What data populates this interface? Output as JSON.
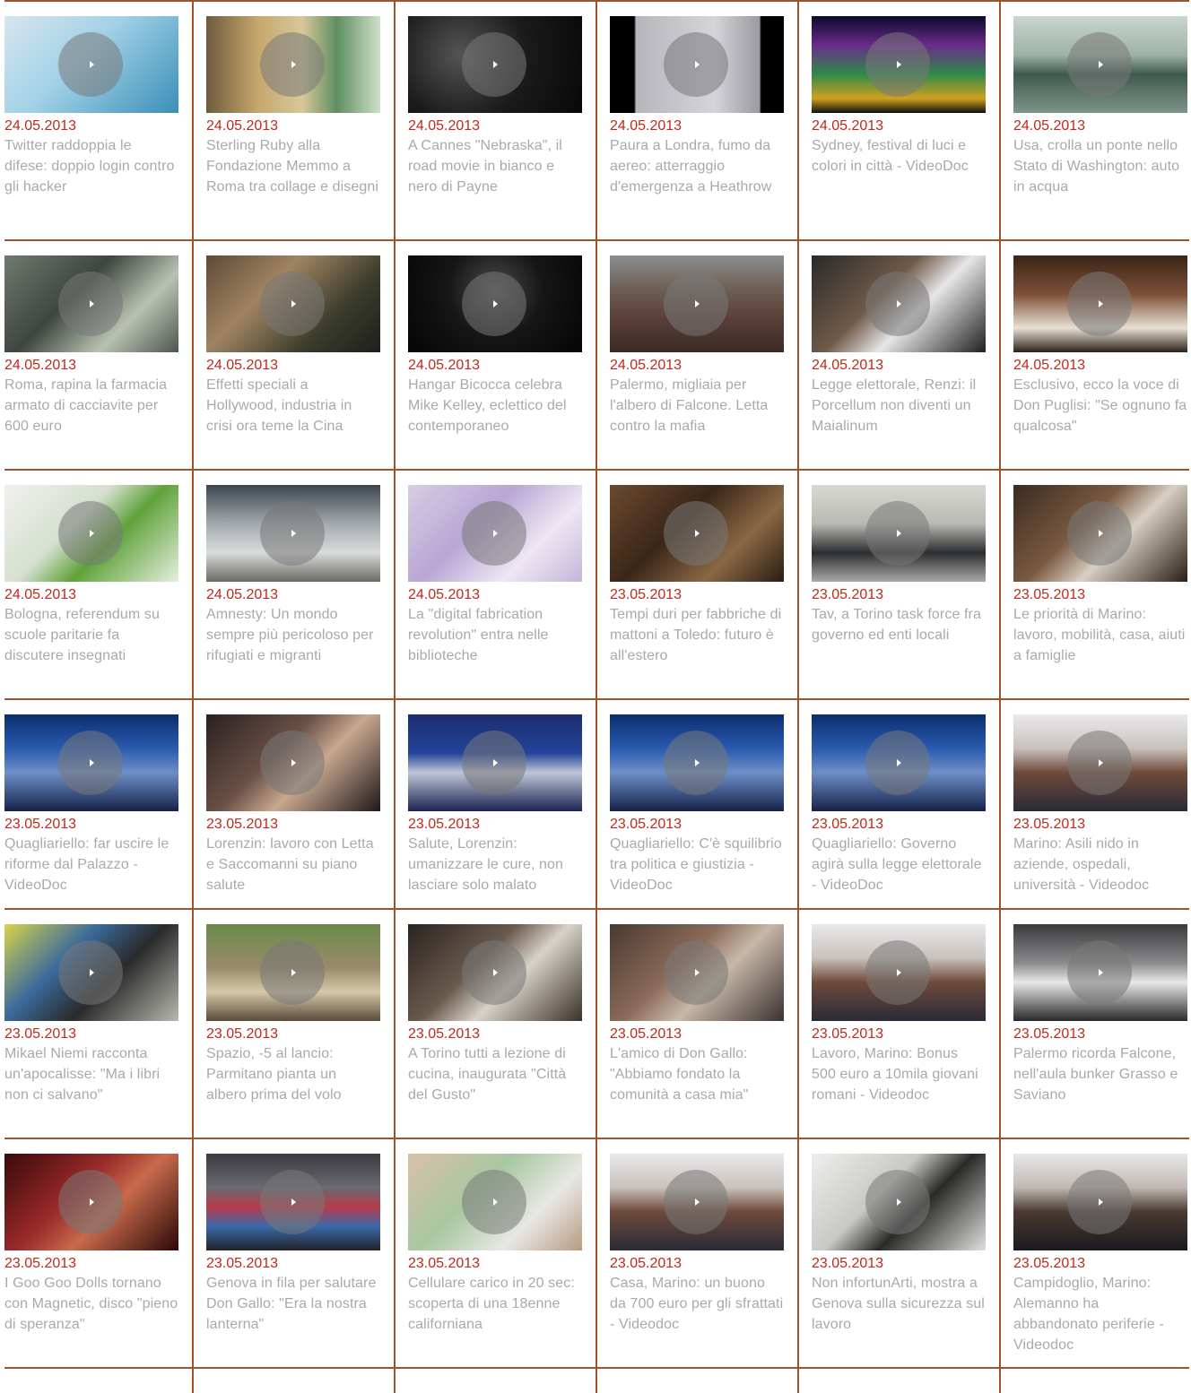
{
  "colors": {
    "divider": "#a0522d",
    "date": "#c0281a",
    "title": "#a9a9a9"
  },
  "icons": {
    "play": "play-icon"
  },
  "videos": [
    {
      "date": "24.05.2013",
      "title": "Twitter raddoppia le difese: doppio login contro gli hacker",
      "thumb": "twitter-what-is"
    },
    {
      "date": "24.05.2013",
      "title": "Sterling Ruby alla Fondazione Memmo a Roma tra collage e disegni",
      "thumb": "gallery-panels"
    },
    {
      "date": "24.05.2013",
      "title": "A Cannes \"Nebraska\", il road movie in bianco e nero di Payne",
      "thumb": "dark-stage"
    },
    {
      "date": "24.05.2013",
      "title": "Paura a Londra, fumo da aereo: atterraggio d'emergenza a Heathrow",
      "thumb": "plane-sky"
    },
    {
      "date": "24.05.2013",
      "title": "Sydney, festival di luci e colori in città - VideoDoc",
      "thumb": "lights-building"
    },
    {
      "date": "24.05.2013",
      "title": "Usa, crolla un ponte nello Stato di Washington: auto in acqua",
      "thumb": "bridge-river"
    },
    {
      "date": "24.05.2013",
      "title": "Roma, rapina la farmacia armato di cacciavite per 600 euro",
      "thumb": "cctv-pharmacy"
    },
    {
      "date": "24.05.2013",
      "title": "Effetti speciali a Hollywood, industria in crisi ora teme la Cina",
      "thumb": "vfx-screen"
    },
    {
      "date": "24.05.2013",
      "title": "Hangar Bicocca celebra Mike Kelley, eclettico del contemporaneo",
      "thumb": "hangar-dark"
    },
    {
      "date": "24.05.2013",
      "title": "Palermo, migliaia per l'albero di Falcone. Letta contro la mafia",
      "thumb": "crowd-street"
    },
    {
      "date": "24.05.2013",
      "title": "Legge elettorale, Renzi: il Porcellum non diventi un Maialinum",
      "thumb": "renzi"
    },
    {
      "date": "24.05.2013",
      "title": "Esclusivo, ecco la voce di Don Puglisi: \"Se ognuno fa qualcosa\"",
      "thumb": "priest"
    },
    {
      "date": "24.05.2013",
      "title": "Bologna, referendum su scuole paritarie fa discutere insegnati",
      "thumb": "ballot"
    },
    {
      "date": "24.05.2013",
      "title": "Amnesty: Un mondo sempre più pericoloso per rifugiati e migranti",
      "thumb": "refugees"
    },
    {
      "date": "24.05.2013",
      "title": "La \"digital fabrication revolution\" entra nelle biblioteche",
      "thumb": "maker-lab"
    },
    {
      "date": "23.05.2013",
      "title": "Tempi duri per fabbriche di mattoni a Toledo: futuro è all'estero",
      "thumb": "brick-factory"
    },
    {
      "date": "23.05.2013",
      "title": "Tav, a Torino task force fra governo ed enti locali",
      "thumb": "press-table"
    },
    {
      "date": "23.05.2013",
      "title": "Le priorità di Marino: lavoro, mobilità, casa, aiuti a famiglie",
      "thumb": "book-hand"
    },
    {
      "date": "23.05.2013",
      "title": "Quagliariello: far uscire le riforme dal Palazzo - VideoDoc",
      "thumb": "studio-blue"
    },
    {
      "date": "23.05.2013",
      "title": "Lorenzin: lavoro con Letta e Saccomanni su piano salute",
      "thumb": "press-crowd"
    },
    {
      "date": "23.05.2013",
      "title": "Salute, Lorenzin: umanizzare le cure, non lasciare solo malato",
      "thumb": "poster-blue"
    },
    {
      "date": "23.05.2013",
      "title": "Quagliariello: C'è squilibrio tra politica e giustizia - VideoDoc",
      "thumb": "studio-blue"
    },
    {
      "date": "23.05.2013",
      "title": "Quagliariello: Governo agirà sulla legge elettorale - VideoDoc",
      "thumb": "studio-blue"
    },
    {
      "date": "23.05.2013",
      "title": "Marino: Asili nido in aziende, ospedali, università - Videodoc",
      "thumb": "marino-sindaco"
    },
    {
      "date": "23.05.2013",
      "title": "Mikael Niemi racconta un'apocalisse: \"Ma i libri non ci salvano\"",
      "thumb": "book-fair"
    },
    {
      "date": "23.05.2013",
      "title": "Spazio, -5 al lancio: Parmitano pianta un albero prima del volo",
      "thumb": "tree-planting"
    },
    {
      "date": "23.05.2013",
      "title": "A Torino tutti a lezione di cucina, inaugurata \"Città del Gusto\"",
      "thumb": "chef"
    },
    {
      "date": "23.05.2013",
      "title": "L'amico di Don Gallo: \"Abbiamo fondato la comunità a casa mia\"",
      "thumb": "old-man"
    },
    {
      "date": "23.05.2013",
      "title": "Lavoro, Marino: Bonus 500 euro a 10mila giovani romani - Videodoc",
      "thumb": "marino-sindaco"
    },
    {
      "date": "23.05.2013",
      "title": "Palermo ricorda Falcone, nell'aula bunker Grasso e Saviano",
      "thumb": "bunker-hall"
    },
    {
      "date": "23.05.2013",
      "title": "I Goo Goo Dolls tornano con Magnetic, disco \"pieno di speranza\"",
      "thumb": "band-red"
    },
    {
      "date": "23.05.2013",
      "title": "Genova in fila per salutare Don Gallo: \"Era la nostra lanterna\"",
      "thumb": "coffin-flags"
    },
    {
      "date": "23.05.2013",
      "title": "Cellulare carico in 20 sec: scoperta di una 18enne californiana",
      "thumb": "goggles-girl"
    },
    {
      "date": "23.05.2013",
      "title": "Casa, Marino: un buono da 700 euro per gli sfrattati - Videodoc",
      "thumb": "marino-sindaco"
    },
    {
      "date": "23.05.2013",
      "title": "Non infortunArti, mostra a Genova sulla sicurezza sul lavoro",
      "thumb": "wall-art"
    },
    {
      "date": "23.05.2013",
      "title": "Campidoglio, Marino: Alemanno ha abbandonato periferie - Videodoc",
      "thumb": "marino-mics"
    }
  ]
}
